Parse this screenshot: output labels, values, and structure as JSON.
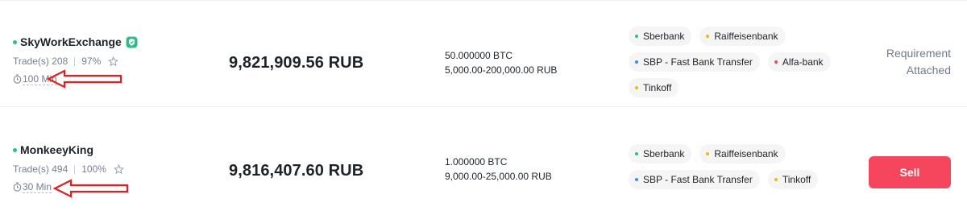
{
  "colors": {
    "online": "#2ebd85",
    "sell": "#f6465d",
    "annotation_arrow": "#e02020",
    "muted_text": "#76808f"
  },
  "ads": [
    {
      "name": "SkyWorkExchange",
      "verified_icon": "verified-shield-icon",
      "trades": "Trade(s) 208",
      "completion": "97%",
      "time": "100 Min",
      "price": "9,821,909.56 RUB",
      "available": "50.000000 BTC",
      "limit": "5,000.00-200,000.00 RUB",
      "payments": [
        {
          "label": "Sberbank",
          "color": "#2ebd85"
        },
        {
          "label": "Raiffeisenbank",
          "color": "#f0b90b"
        },
        {
          "label": "SBP - Fast Bank Transfer",
          "color": "#3d8af7"
        },
        {
          "label": "Alfa-bank",
          "color": "#f6465d"
        },
        {
          "label": "Tinkoff",
          "color": "#f0b90b"
        }
      ],
      "action": {
        "type": "requirement",
        "label_line1": "Requirement",
        "label_line2": "Attached"
      }
    },
    {
      "name": "MonkeeyKing",
      "trades": "Trade(s) 494",
      "completion": "100%",
      "time": "30 Min",
      "price": "9,816,407.60 RUB",
      "available": "1.000000 BTC",
      "limit": "9,000.00-25,000.00 RUB",
      "payments": [
        {
          "label": "Sberbank",
          "color": "#2ebd85"
        },
        {
          "label": "Raiffeisenbank",
          "color": "#f0b90b"
        },
        {
          "label": "SBP - Fast Bank Transfer",
          "color": "#3d8af7"
        },
        {
          "label": "Tinkoff",
          "color": "#f0b90b"
        }
      ],
      "action": {
        "type": "button",
        "label": "Sell"
      }
    }
  ]
}
